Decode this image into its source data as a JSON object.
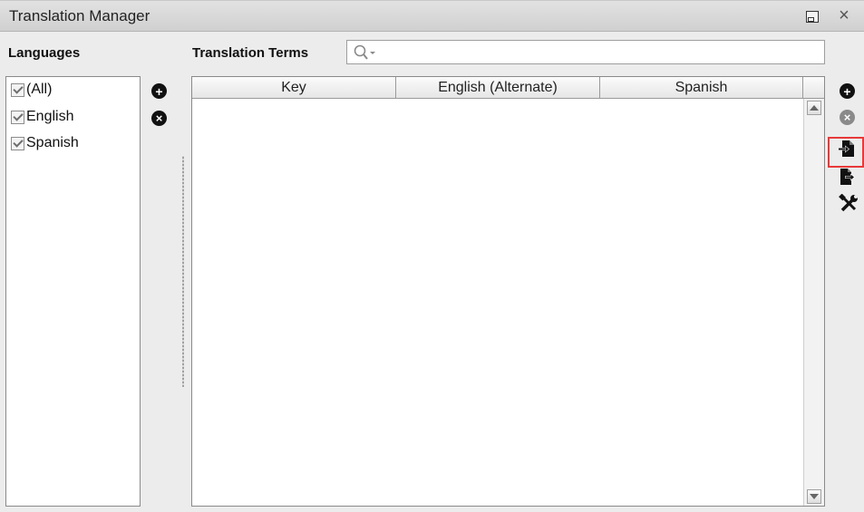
{
  "window": {
    "title": "Translation Manager",
    "restore_icon": "restore-window-icon",
    "close_icon": "close-icon",
    "close_glyph": "×"
  },
  "languages_panel": {
    "label": "Languages",
    "items": [
      {
        "label": "(All)",
        "checked": true
      },
      {
        "label": "English",
        "checked": true
      },
      {
        "label": "Spanish",
        "checked": true
      }
    ],
    "add_icon": "add-circle-icon",
    "remove_icon": "remove-circle-icon",
    "add_glyph": "+",
    "remove_glyph": "×"
  },
  "terms_panel": {
    "label": "Translation Terms",
    "search": {
      "value": "",
      "placeholder": "",
      "icon": "search-dropdown-icon"
    },
    "columns": [
      "Key",
      "English (Alternate)",
      "Spanish"
    ],
    "rows": []
  },
  "right_toolbar": {
    "add_glyph": "+",
    "remove_glyph": "×",
    "tools": [
      {
        "name": "add-term-icon",
        "enabled": true
      },
      {
        "name": "remove-term-icon",
        "enabled": false
      },
      {
        "name": "import-icon",
        "enabled": true,
        "highlighted": true
      },
      {
        "name": "export-icon",
        "enabled": true
      },
      {
        "name": "tools-icon",
        "enabled": true
      }
    ]
  },
  "colors": {
    "highlight": "#e8393a",
    "panel_bg": "#ececec"
  }
}
